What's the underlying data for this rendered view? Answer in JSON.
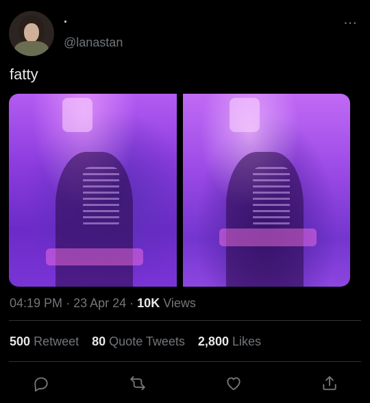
{
  "author": {
    "display_name": "·",
    "handle": "@lanastan"
  },
  "tweet": {
    "text": "fatty"
  },
  "meta": {
    "time": "04:19 PM",
    "separator": "·",
    "date": "23 Apr 24",
    "views_count": "10K",
    "views_label": "Views"
  },
  "stats": {
    "retweets": {
      "count": "500",
      "label": "Retweet"
    },
    "quotes": {
      "count": "80",
      "label": "Quote Tweets"
    },
    "likes": {
      "count": "2,800",
      "label": "Likes"
    }
  },
  "more_icon": "⋯",
  "icons": {
    "reply": "reply-icon",
    "retweet": "retweet-icon",
    "like": "heart-icon",
    "share": "share-icon"
  },
  "colors": {
    "background": "#000000",
    "text_primary": "#e7e9ea",
    "text_secondary": "#71767b",
    "divider": "#2f3336"
  }
}
